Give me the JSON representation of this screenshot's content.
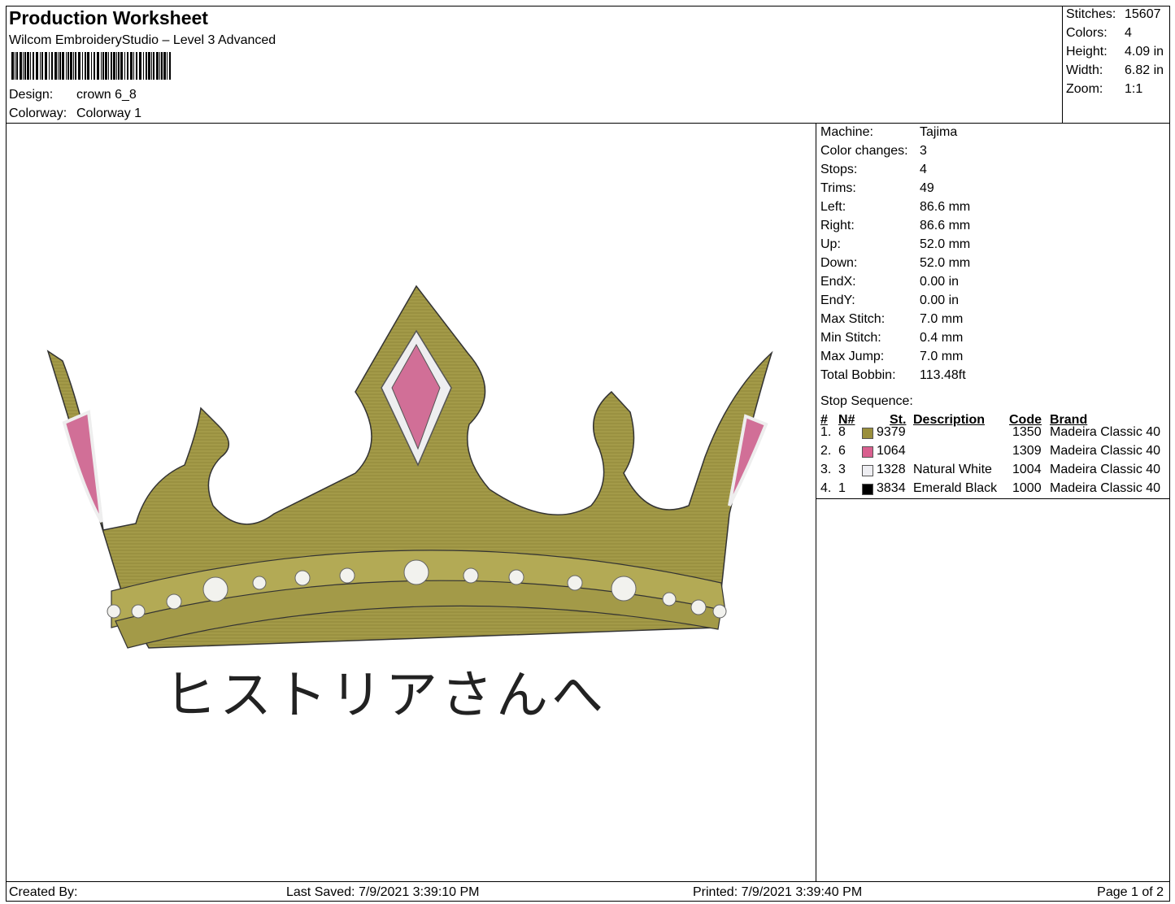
{
  "header": {
    "title": "Production Worksheet",
    "subtitle": "Wilcom EmbroideryStudio – Level 3 Advanced",
    "design_label": "Design:",
    "design_value": "crown 6_8",
    "colorway_label": "Colorway:",
    "colorway_value": "Colorway 1"
  },
  "summary": [
    {
      "label": "Stitches:",
      "value": "15607"
    },
    {
      "label": "Colors:",
      "value": "4"
    },
    {
      "label": "Height:",
      "value": "4.09 in"
    },
    {
      "label": "Width:",
      "value": "6.82 in"
    },
    {
      "label": "Zoom:",
      "value": "1:1"
    }
  ],
  "details": [
    {
      "label": "Machine:",
      "value": "Tajima"
    },
    {
      "label": "Color changes:",
      "value": "3"
    },
    {
      "label": "Stops:",
      "value": "4"
    },
    {
      "label": "Trims:",
      "value": "49"
    },
    {
      "label": "Left:",
      "value": "86.6 mm"
    },
    {
      "label": "Right:",
      "value": "86.6 mm"
    },
    {
      "label": "Up:",
      "value": "52.0 mm"
    },
    {
      "label": "Down:",
      "value": "52.0 mm"
    },
    {
      "label": "EndX:",
      "value": "0.00 in"
    },
    {
      "label": "EndY:",
      "value": "0.00 in"
    },
    {
      "label": "Max Stitch:",
      "value": "7.0 mm"
    },
    {
      "label": "Min Stitch:",
      "value": "0.4 mm"
    },
    {
      "label": "Max Jump:",
      "value": "7.0 mm"
    },
    {
      "label": "Total Bobbin:",
      "value": "113.48ft"
    }
  ],
  "stop_sequence": {
    "title": "Stop Sequence:",
    "columns": {
      "num": "#",
      "needle": "N#",
      "st": "St.",
      "description": "Description",
      "code": "Code",
      "brand": "Brand"
    },
    "rows": [
      {
        "num": "1.",
        "needle": "8",
        "color": "#9a8f3c",
        "st": "9379",
        "description": "",
        "code": "1350",
        "brand": "Madeira Classic 40"
      },
      {
        "num": "2.",
        "needle": "6",
        "color": "#d9608f",
        "st": "1064",
        "description": "",
        "code": "1309",
        "brand": "Madeira Classic 40"
      },
      {
        "num": "3.",
        "needle": "3",
        "color": "#eeeef2",
        "st": "1328",
        "description": "Natural White",
        "code": "1004",
        "brand": "Madeira Classic 40"
      },
      {
        "num": "4.",
        "needle": "1",
        "color": "#000000",
        "st": "3834",
        "description": "Emerald Black",
        "code": "1000",
        "brand": "Madeira Classic 40"
      }
    ]
  },
  "design_preview": {
    "caption": "ヒストリアさんへ"
  },
  "footer": {
    "created_by": "Created By:",
    "last_saved": "Last Saved: 7/9/2021 3:39:10 PM",
    "printed": "Printed: 7/9/2021 3:39:40 PM",
    "page": "Page 1 of 2"
  }
}
